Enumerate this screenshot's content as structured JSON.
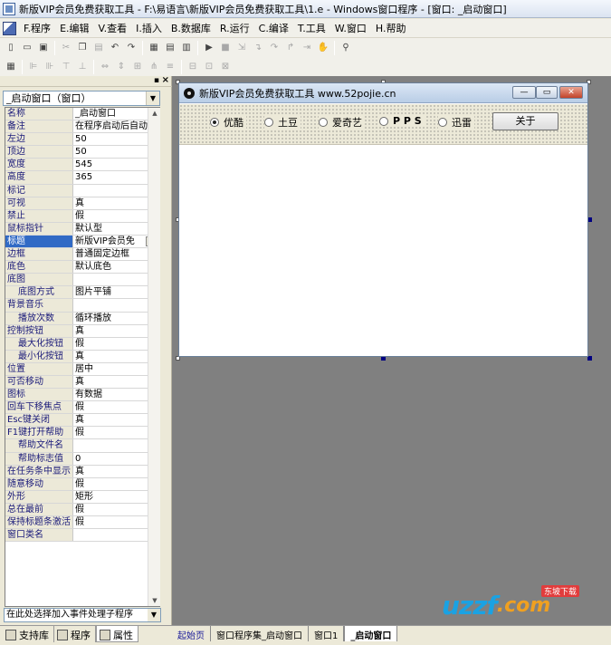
{
  "window": {
    "title": "新版VIP会员免费获取工具 - F:\\易语言\\新版VIP会员免费获取工具\\1.e - Windows窗口程序 - [窗口: _启动窗口]"
  },
  "menu": [
    "F.程序",
    "E.编辑",
    "V.查看",
    "I.插入",
    "B.数据库",
    "R.运行",
    "C.编译",
    "T.工具",
    "W.窗口",
    "H.帮助"
  ],
  "left_panel": {
    "object_selector": "_启动窗口（窗口）",
    "event_selector": "在此处选择加入事件处理子程序",
    "properties": [
      {
        "k": "名称",
        "v": "_启动窗口"
      },
      {
        "k": "备注",
        "v": "在程序启动后自动"
      },
      {
        "k": "左边",
        "v": "50"
      },
      {
        "k": "顶边",
        "v": "50"
      },
      {
        "k": "宽度",
        "v": "545"
      },
      {
        "k": "高度",
        "v": "365"
      },
      {
        "k": "标记",
        "v": ""
      },
      {
        "k": "可视",
        "v": "真"
      },
      {
        "k": "禁止",
        "v": "假"
      },
      {
        "k": "鼠标指针",
        "v": "默认型"
      },
      {
        "k": "标题",
        "v": "新版VIP会员免"
      },
      {
        "k": "边框",
        "v": "普通固定边框"
      },
      {
        "k": "底色",
        "v": "默认底色"
      },
      {
        "k": "底图",
        "v": ""
      },
      {
        "k": "底图方式",
        "v": "图片平铺"
      },
      {
        "k": "背景音乐",
        "v": ""
      },
      {
        "k": "播放次数",
        "v": "循环播放"
      },
      {
        "k": "控制按钮",
        "v": "真"
      },
      {
        "k": "最大化按钮",
        "v": "假"
      },
      {
        "k": "最小化按钮",
        "v": "真"
      },
      {
        "k": "位置",
        "v": "居中"
      },
      {
        "k": "可否移动",
        "v": "真"
      },
      {
        "k": "图标",
        "v": "有数据"
      },
      {
        "k": "回车下移焦点",
        "v": "假"
      },
      {
        "k": "Esc键关闭",
        "v": "真"
      },
      {
        "k": "F1键打开帮助",
        "v": "假"
      },
      {
        "k": "帮助文件名",
        "v": ""
      },
      {
        "k": "帮助标志值",
        "v": "0"
      },
      {
        "k": "在任务条中显示",
        "v": "真"
      },
      {
        "k": "随意移动",
        "v": "假"
      },
      {
        "k": "外形",
        "v": "矩形"
      },
      {
        "k": "总在最前",
        "v": "假"
      },
      {
        "k": "保持标题条激活",
        "v": "假"
      },
      {
        "k": "窗口类名",
        "v": ""
      }
    ],
    "tabs": [
      "支持库",
      "程序",
      "属性"
    ]
  },
  "form": {
    "title": "新版VIP会员免费获取工具    www.52pojie.cn",
    "radios": [
      "优酷",
      "土豆",
      "爱奇艺",
      "P P S",
      "迅雷"
    ],
    "selected_radio": "优酷",
    "close_button": "关于"
  },
  "doc_tabs": [
    "起始页",
    "窗口程序集_启动窗口",
    "窗口1",
    "_启动窗口"
  ],
  "watermark": {
    "brand": "uzzf",
    "domain": ".com",
    "tag": "东坡下载"
  }
}
